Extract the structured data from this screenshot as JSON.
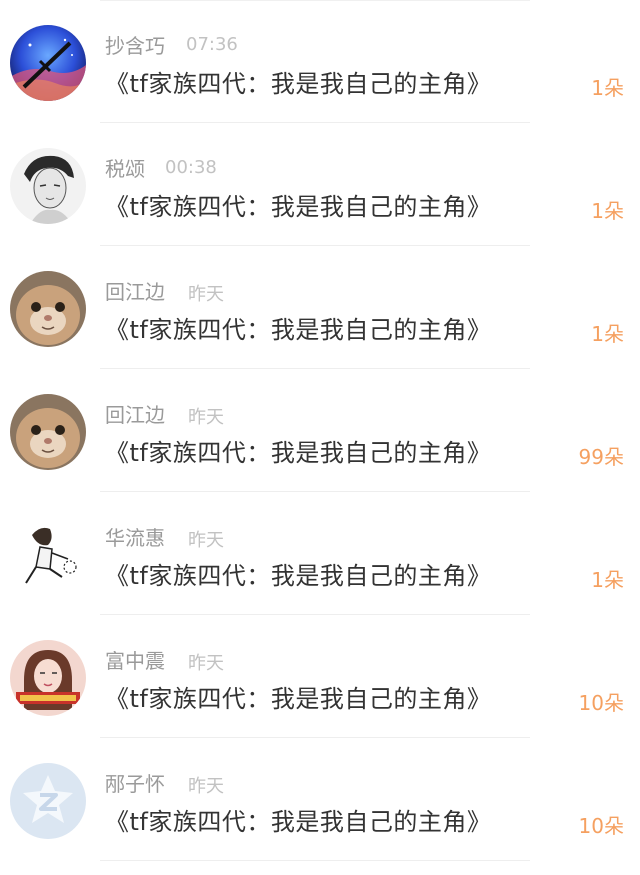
{
  "items": [
    {
      "name": "抄含巧",
      "time": "07:36",
      "title": "《tf家族四代：我是我自己的主角》",
      "count": "1朵",
      "avatar": "space-icon"
    },
    {
      "name": "税颂",
      "time": "00:38",
      "title": "《tf家族四代：我是我自己的主角》",
      "count": "1朵",
      "avatar": "sketch-portrait-icon"
    },
    {
      "name": "回江边",
      "time": "昨天",
      "title": "《tf家族四代：我是我自己的主角》",
      "count": "1朵",
      "avatar": "cat-photo-icon"
    },
    {
      "name": "回江边",
      "time": "昨天",
      "title": "《tf家族四代：我是我自己的主角》",
      "count": "99朵",
      "avatar": "cat-photo-icon"
    },
    {
      "name": "华流惠",
      "time": "昨天",
      "title": "《tf家族四代：我是我自己的主角》",
      "count": "1朵",
      "avatar": "sketch-figure-icon"
    },
    {
      "name": "富中震",
      "time": "昨天",
      "title": "《tf家族四代：我是我自己的主角》",
      "count": "10朵",
      "avatar": "girl-photo-icon"
    },
    {
      "name": "邴子怀",
      "time": "昨天",
      "title": "《tf家族四代：我是我自己的主角》",
      "count": "10朵",
      "avatar": "default-logo-icon"
    }
  ],
  "colors": {
    "name": "#9a9a9a",
    "time": "#c2c2c2",
    "title": "#333333",
    "count": "#f5a060",
    "divider": "#eeeeee"
  }
}
